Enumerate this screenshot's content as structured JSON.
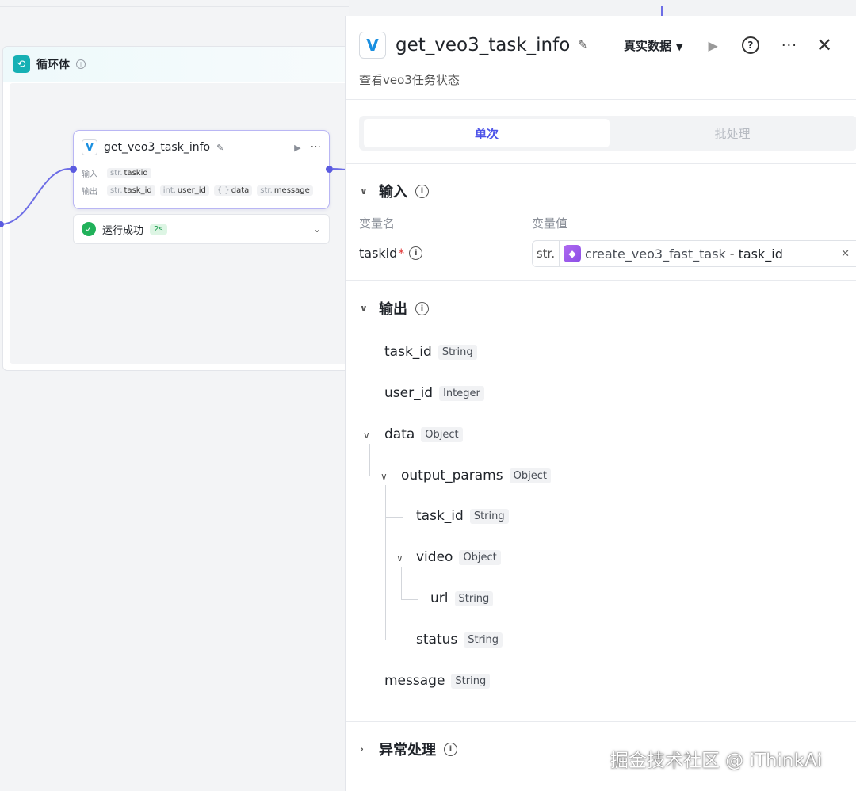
{
  "canvas": {
    "loop_title": "循环体",
    "node": {
      "title": "get_veo3_task_info",
      "input_label": "输入",
      "output_label": "输出",
      "inputs": [
        {
          "type": "str.",
          "name": "taskid"
        }
      ],
      "outputs": [
        {
          "type": "str.",
          "name": "task_id"
        },
        {
          "type": "int.",
          "name": "user_id"
        },
        {
          "type": "{ }",
          "name": "data"
        },
        {
          "type": "str.",
          "name": "message"
        }
      ]
    },
    "status": {
      "text": "运行成功",
      "duration": "2s"
    }
  },
  "panel": {
    "title": "get_veo3_task_info",
    "description": "查看veo3任务状态",
    "data_mode": "真实数据",
    "tabs": [
      {
        "label": "单次",
        "active": true
      },
      {
        "label": "批处理",
        "active": false
      }
    ],
    "input_section": {
      "title": "输入",
      "col_name": "变量名",
      "col_value": "变量值",
      "param_name": "taskid",
      "param_required": "*",
      "ref_type": "str.",
      "ref_node": "create_veo3_fast_task",
      "ref_sep": "-",
      "ref_field": "task_id"
    },
    "output_section": {
      "title": "输出",
      "tree": [
        {
          "id": "task_id",
          "name": "task_id",
          "type": "String"
        },
        {
          "id": "user_id",
          "name": "user_id",
          "type": "Integer"
        },
        {
          "id": "data",
          "name": "data",
          "type": "Object"
        },
        {
          "id": "output_params",
          "name": "output_params",
          "type": "Object"
        },
        {
          "id": "op_task_id",
          "name": "task_id",
          "type": "String"
        },
        {
          "id": "video",
          "name": "video",
          "type": "Object"
        },
        {
          "id": "url",
          "name": "url",
          "type": "String"
        },
        {
          "id": "status",
          "name": "status",
          "type": "String"
        },
        {
          "id": "message",
          "name": "message",
          "type": "String"
        }
      ]
    },
    "error_section": {
      "title": "异常处理"
    }
  },
  "watermark": "掘金技术社区 @ iThinkAi",
  "colors": {
    "accent": "#4d53e8",
    "success": "#21b15a",
    "loop": "#16b0b4",
    "port": "#5b5be0"
  }
}
